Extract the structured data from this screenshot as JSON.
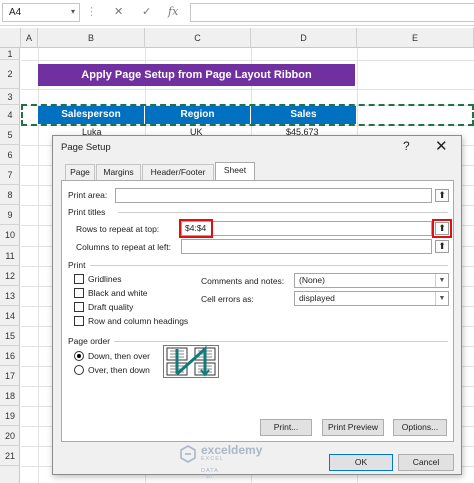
{
  "formula_bar": {
    "name_box": "A4",
    "cancel_glyph": "✕",
    "enter_glyph": "✓",
    "fx": "fx"
  },
  "columns": [
    "A",
    "B",
    "C",
    "D",
    "E"
  ],
  "rows": [
    "1",
    "2",
    "3",
    "4",
    "5",
    "6",
    "7",
    "8",
    "9",
    "10",
    "11",
    "12",
    "13",
    "14",
    "15",
    "16",
    "17",
    "18",
    "19",
    "20",
    "21"
  ],
  "sheet": {
    "banner": "Apply Page Setup from Page Layout Ribbon",
    "headers": [
      "Salesperson",
      "Region",
      "Sales"
    ],
    "row5": [
      "Luka",
      "UK",
      "$45,673"
    ]
  },
  "dialog": {
    "title": "Page Setup",
    "help": "?",
    "close": "✕",
    "tabs": [
      "Page",
      "Margins",
      "Header/Footer",
      "Sheet"
    ],
    "active_tab": "Sheet",
    "print_area_label": "Print area:",
    "print_titles_label": "Print titles",
    "rows_repeat_label": "Rows to repeat at top:",
    "rows_repeat_value": "$4:$4",
    "cols_repeat_label": "Columns to repeat at left:",
    "cols_repeat_value": "",
    "print_label": "Print",
    "checkboxes": [
      "Gridlines",
      "Black and white",
      "Draft quality",
      "Row and column headings"
    ],
    "comments_label": "Comments and notes:",
    "comments_value": "(None)",
    "errors_label": "Cell errors as:",
    "errors_value": "displayed",
    "page_order_label": "Page order",
    "radio_down": "Down, then over",
    "radio_over": "Over, then down",
    "selected_order": "Down, then over",
    "buttons": {
      "print": "Print...",
      "preview": "Print Preview",
      "options": "Options...",
      "ok": "OK",
      "cancel": "Cancel"
    }
  },
  "watermark": {
    "name": "exceldemy",
    "tagline": "EXCEL · DATA · BI"
  },
  "colors": {
    "banner": "#7030a0",
    "header": "#0070c0",
    "highlight": "#e01010",
    "dash": "#217346"
  }
}
